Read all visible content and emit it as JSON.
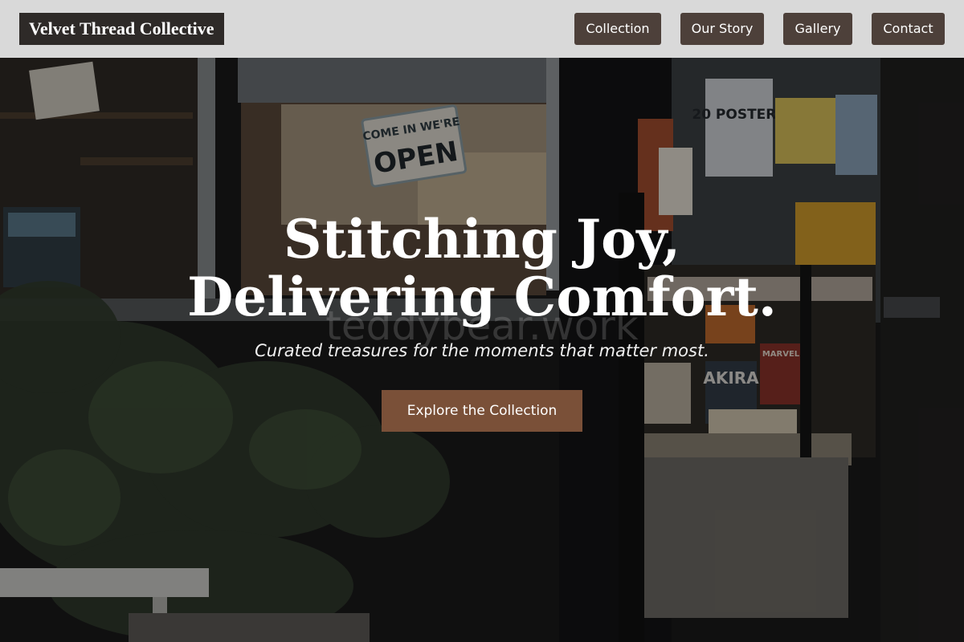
{
  "colors": {
    "navbar_bg": "#e8e8e8",
    "brand_bg": "#2e2a28",
    "nav_button_bg": "#4d403a",
    "cta_bg": "#7a5038",
    "text": "#ffffff"
  },
  "navbar": {
    "brand": "Velvet Thread Collective",
    "links": [
      {
        "label": "Collection"
      },
      {
        "label": "Our Story"
      },
      {
        "label": "Gallery"
      },
      {
        "label": "Contact"
      }
    ]
  },
  "hero": {
    "headline": "Stitching Joy, Delivering Comfort.",
    "watermark": "teddybear.work",
    "tagline": "Curated treasures for the moments that matter most.",
    "cta_label": "Explore the Collection",
    "background": {
      "signs": [
        {
          "text": "COME IN WE'RE"
        },
        {
          "text": "OPEN"
        },
        {
          "text": "20 POSTERS"
        },
        {
          "text": "AKIRA"
        },
        {
          "text": "MARVEL"
        }
      ]
    }
  }
}
